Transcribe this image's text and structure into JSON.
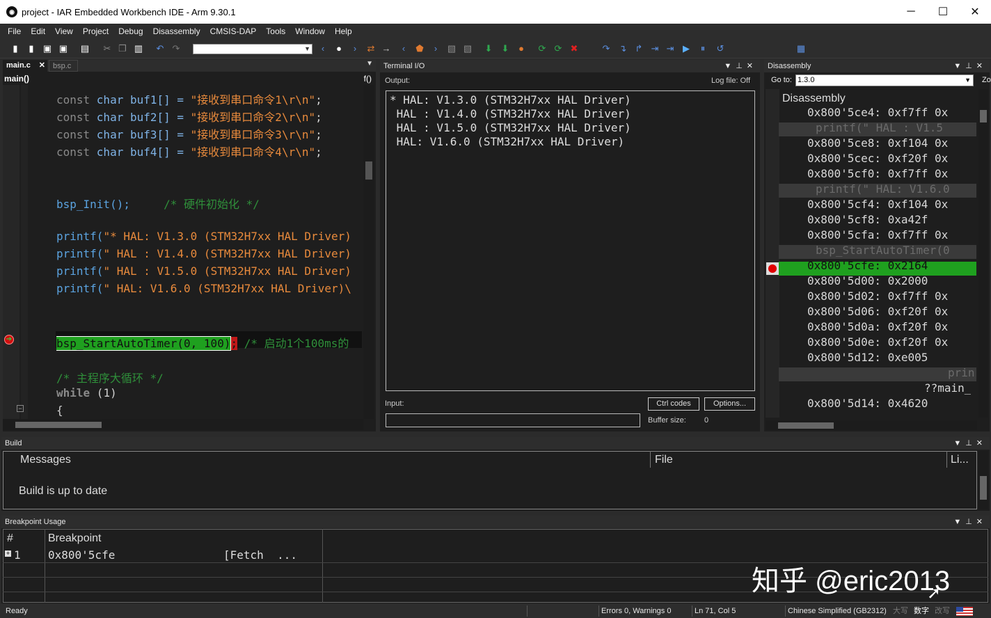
{
  "window": {
    "title": "project - IAR Embedded Workbench IDE - Arm 9.30.1",
    "min": "─",
    "max": "☐",
    "close": "✕"
  },
  "menu": [
    "File",
    "Edit",
    "View",
    "Project",
    "Debug",
    "Disassembly",
    "CMSIS-DAP",
    "Tools",
    "Window",
    "Help"
  ],
  "editor": {
    "tabs": [
      "main.c",
      "bsp.c"
    ],
    "tab_close": "✕",
    "func_combo": "main()",
    "func_icon": "f()",
    "lines": {
      "buf1": {
        "kw": "const ",
        "ty": "char ",
        "name": "buf1[] = ",
        "str": "\"接收到串口命令1\\r\\n\"",
        ";": ";"
      },
      "buf2": {
        "kw": "const ",
        "ty": "char ",
        "name": "buf2[] = ",
        "str": "\"接收到串口命令2\\r\\n\"",
        ";": ";"
      },
      "buf3": {
        "kw": "const ",
        "ty": "char ",
        "name": "buf3[] = ",
        "str": "\"接收到串口命令3\\r\\n\"",
        ";": ";"
      },
      "buf4": {
        "kw": "const ",
        "ty": "char ",
        "name": "buf4[] = ",
        "str": "\"接收到串口命令4\\r\\n\"",
        ";": ";"
      },
      "init": {
        "fn": "bsp_Init();",
        "cm": "     /* 硬件初始化 */"
      },
      "p1": {
        "fn": "printf(",
        "str": "\"* HAL: V1.3.0 (STM32H7xx HAL Driver)"
      },
      "p2": {
        "fn": "printf(",
        "str": "\" HAL : V1.4.0 (STM32H7xx HAL Driver)"
      },
      "p3": {
        "fn": "printf(",
        "str": "\" HAL : V1.5.0 (STM32H7xx HAL Driver)"
      },
      "p4": {
        "fn": "printf(",
        "str": "\" HAL: V1.6.0 (STM32H7xx HAL Driver)\\"
      },
      "timer": {
        "hl": "bsp_StartAutoTimer(0, 100)",
        "semi": ";",
        "cm": " /* 启动1个100ms的"
      },
      "loopcm": "/* 主程序大循环 */",
      "while_kw": "while",
      "while_rest": " (1)",
      "brace": "{"
    }
  },
  "terminal": {
    "title": "Terminal I/O",
    "output_label": "Output:",
    "logfile": "Log file: Off",
    "lines": [
      "* HAL: V1.3.0 (STM32H7xx HAL Driver)",
      " HAL : V1.4.0 (STM32H7xx HAL Driver)",
      " HAL : V1.5.0 (STM32H7xx HAL Driver)",
      " HAL: V1.6.0 (STM32H7xx HAL Driver)"
    ],
    "input_label": "Input:",
    "ctrl_codes": "Ctrl codes",
    "options": "Options...",
    "buffer_label": "Buffer size:",
    "buffer_value": "0"
  },
  "disassembly": {
    "title": "Disassembly",
    "goto_label": "Go to:",
    "goto_value": "1.3.0",
    "zoom": "Zo",
    "header": "Disassembly",
    "rows": [
      {
        "t": "addr",
        "v": "0x800'5ce4: 0xf7ff 0x"
      },
      {
        "t": "src",
        "v": "printf(\" HAL : V1.5"
      },
      {
        "t": "addr",
        "v": "0x800'5ce8: 0xf104 0x"
      },
      {
        "t": "addr",
        "v": "0x800'5cec: 0xf20f 0x"
      },
      {
        "t": "addr",
        "v": "0x800'5cf0: 0xf7ff 0x"
      },
      {
        "t": "src",
        "v": "printf(\" HAL: V1.6.0"
      },
      {
        "t": "addr",
        "v": "0x800'5cf4: 0xf104 0x"
      },
      {
        "t": "addr",
        "v": "0x800'5cf8: 0xa42f"
      },
      {
        "t": "addr",
        "v": "0x800'5cfa: 0xf7ff 0x"
      },
      {
        "t": "src",
        "v": "bsp_StartAutoTimer(0"
      },
      {
        "t": "cur",
        "v": "0x800'5cfe: 0x2164"
      },
      {
        "t": "addr",
        "v": "0x800'5d00: 0x2000"
      },
      {
        "t": "addr",
        "v": "0x800'5d02: 0xf7ff 0x"
      },
      {
        "t": "addr",
        "v": "0x800'5d06: 0xf20f 0x"
      },
      {
        "t": "addr",
        "v": "0x800'5d0a: 0xf20f 0x"
      },
      {
        "t": "addr",
        "v": "0x800'5d0e: 0xf20f 0x"
      },
      {
        "t": "addr",
        "v": "0x800'5d12: 0xe005"
      },
      {
        "t": "srcr",
        "v": "prin"
      },
      {
        "t": "lbl",
        "v": "??main_"
      },
      {
        "t": "addr",
        "v": "0x800'5d14: 0x4620"
      }
    ]
  },
  "build": {
    "title": "Build",
    "col_messages": "Messages",
    "col_file": "File",
    "col_line": "Li...",
    "message": "Build is up to date"
  },
  "breakpoints": {
    "title": "Breakpoint Usage",
    "col_num": "#",
    "col_bp": "Breakpoint",
    "row_num": "1",
    "row_addr": "0x800'5cfe",
    "row_type": "[Fetch  ..."
  },
  "watermark": "知乎 @eric2013",
  "status": {
    "ready": "Ready",
    "errors": "Errors 0, Warnings 0",
    "pos": "Ln 71, Col 5",
    "encoding": "Chinese Simplified (GB2312)",
    "caps": "大写",
    "num": "数字",
    "ovr": "改写"
  },
  "colors": {
    "current_line": "#1fa01f",
    "breakpoint": "#e00000",
    "editor_bg": "#1e1e1e"
  }
}
